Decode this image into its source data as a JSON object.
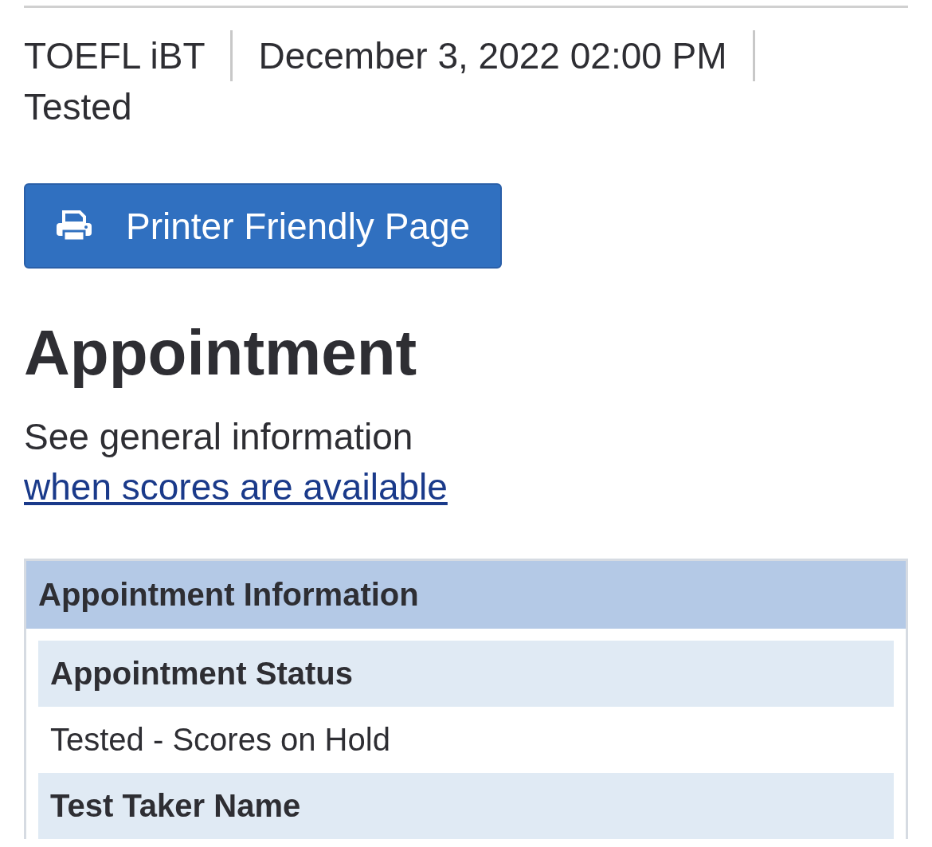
{
  "header_items": [
    "TOEFL iBT",
    "December 3, 2022 02:00 PM",
    "Tested"
  ],
  "print_button": {
    "label": "Printer Friendly Page"
  },
  "heading": "Appointment",
  "intro": {
    "text": "See general information",
    "link": "when scores are available"
  },
  "panel": {
    "title": "Appointment Information",
    "fields": [
      {
        "label": "Appointment Status",
        "value": "Tested - Scores on Hold"
      },
      {
        "label": "Test Taker Name"
      }
    ]
  }
}
